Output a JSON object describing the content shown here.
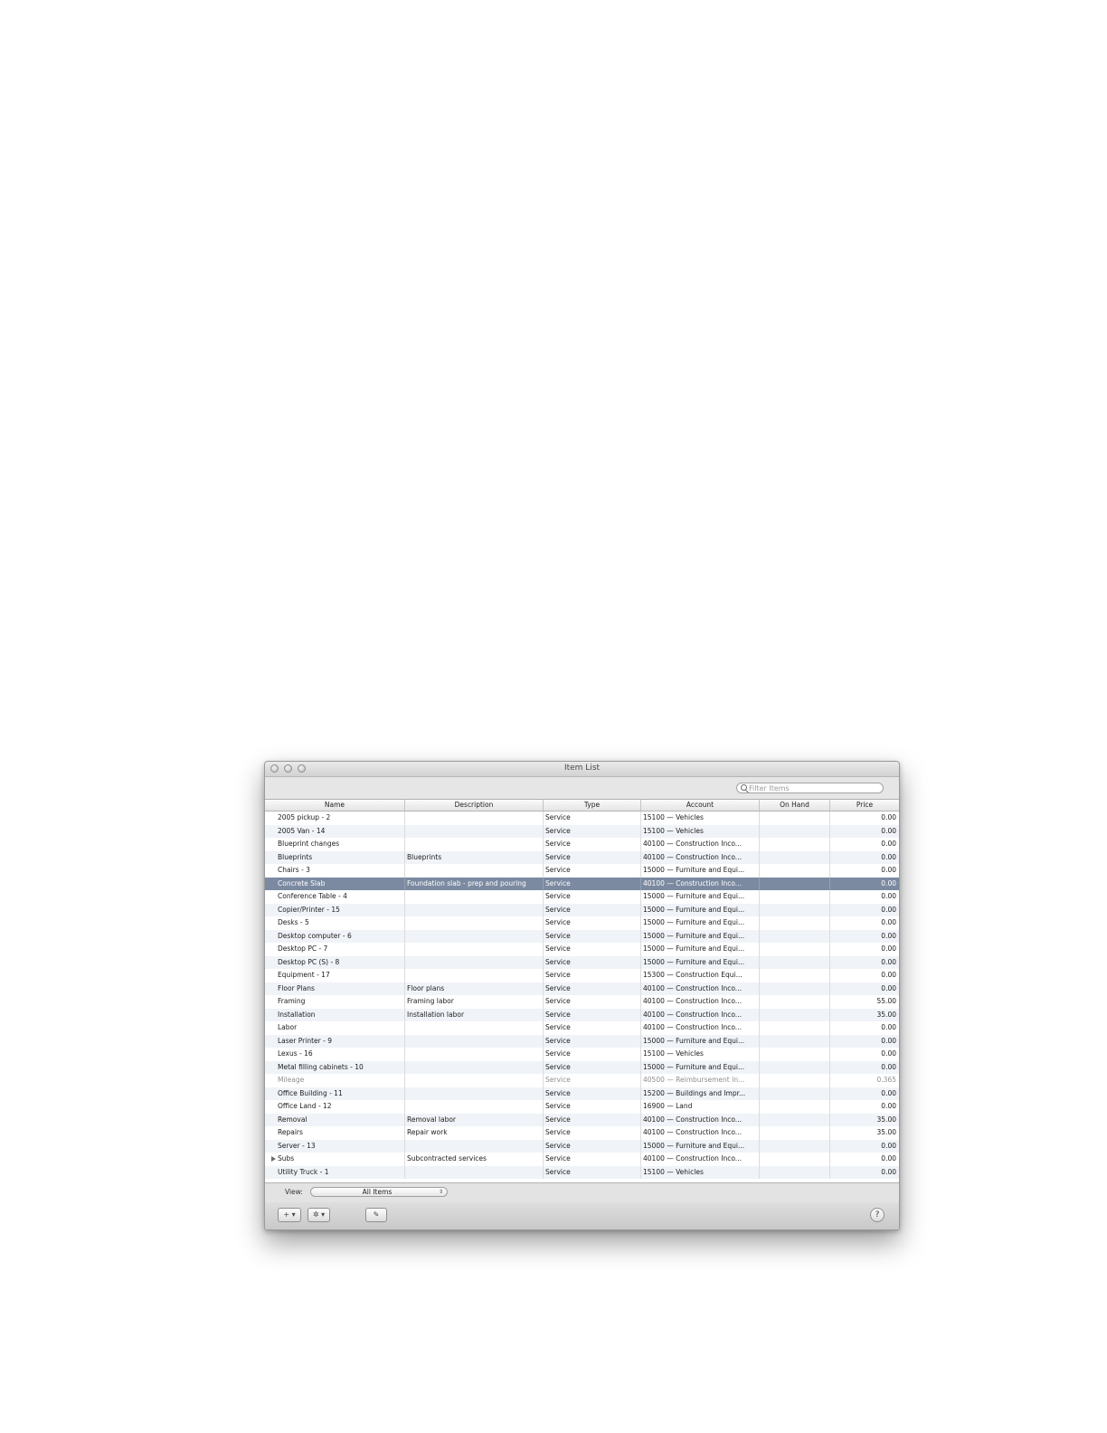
{
  "window": {
    "title": "Item List"
  },
  "search": {
    "placeholder": "Filter Items"
  },
  "table": {
    "columns": [
      "Name",
      "Description",
      "Type",
      "Account",
      "On Hand",
      "Price"
    ],
    "rows": [
      {
        "name": "2005 pickup - 2",
        "description": "",
        "type": "Service",
        "account": "15100 — Vehicles",
        "on_hand": "",
        "price": "0.00"
      },
      {
        "name": "2005 Van - 14",
        "description": "",
        "type": "Service",
        "account": "15100 — Vehicles",
        "on_hand": "",
        "price": "0.00"
      },
      {
        "name": "Blueprint changes",
        "description": "",
        "type": "Service",
        "account": "40100 — Construction Inco...",
        "on_hand": "",
        "price": "0.00"
      },
      {
        "name": "Blueprints",
        "description": "Blueprints",
        "type": "Service",
        "account": "40100 — Construction Inco...",
        "on_hand": "",
        "price": "0.00"
      },
      {
        "name": "Chairs - 3",
        "description": "",
        "type": "Service",
        "account": "15000 — Furniture and Equi...",
        "on_hand": "",
        "price": "0.00"
      },
      {
        "name": "Concrete Slab",
        "description": "Foundation slab - prep and pouring",
        "type": "Service",
        "account": "40100 — Construction Inco...",
        "on_hand": "",
        "price": "0.00",
        "selected": true
      },
      {
        "name": "Conference Table - 4",
        "description": "",
        "type": "Service",
        "account": "15000 — Furniture and Equi...",
        "on_hand": "",
        "price": "0.00"
      },
      {
        "name": "Copier/Printer - 15",
        "description": "",
        "type": "Service",
        "account": "15000 — Furniture and Equi...",
        "on_hand": "",
        "price": "0.00"
      },
      {
        "name": "Desks - 5",
        "description": "",
        "type": "Service",
        "account": "15000 — Furniture and Equi...",
        "on_hand": "",
        "price": "0.00"
      },
      {
        "name": "Desktop computer - 6",
        "description": "",
        "type": "Service",
        "account": "15000 — Furniture and Equi...",
        "on_hand": "",
        "price": "0.00"
      },
      {
        "name": "Desktop PC - 7",
        "description": "",
        "type": "Service",
        "account": "15000 — Furniture and Equi...",
        "on_hand": "",
        "price": "0.00"
      },
      {
        "name": "Desktop PC (S) - 8",
        "description": "",
        "type": "Service",
        "account": "15000 — Furniture and Equi...",
        "on_hand": "",
        "price": "0.00"
      },
      {
        "name": "Equipment - 17",
        "description": "",
        "type": "Service",
        "account": "15300 — Construction Equi...",
        "on_hand": "",
        "price": "0.00"
      },
      {
        "name": "Floor Plans",
        "description": "Floor plans",
        "type": "Service",
        "account": "40100 — Construction Inco...",
        "on_hand": "",
        "price": "0.00"
      },
      {
        "name": "Framing",
        "description": "Framing labor",
        "type": "Service",
        "account": "40100 — Construction Inco...",
        "on_hand": "",
        "price": "55.00"
      },
      {
        "name": "Installation",
        "description": "Installation labor",
        "type": "Service",
        "account": "40100 — Construction Inco...",
        "on_hand": "",
        "price": "35.00"
      },
      {
        "name": "Labor",
        "description": "",
        "type": "Service",
        "account": "40100 — Construction Inco...",
        "on_hand": "",
        "price": "0.00"
      },
      {
        "name": "Laser Printer - 9",
        "description": "",
        "type": "Service",
        "account": "15000 — Furniture and Equi...",
        "on_hand": "",
        "price": "0.00"
      },
      {
        "name": "Lexus - 16",
        "description": "",
        "type": "Service",
        "account": "15100 — Vehicles",
        "on_hand": "",
        "price": "0.00"
      },
      {
        "name": "Metal filling cabinets - 10",
        "description": "",
        "type": "Service",
        "account": "15000 — Furniture and Equi...",
        "on_hand": "",
        "price": "0.00"
      },
      {
        "name": "Mileage",
        "description": "",
        "type": "Service",
        "account": "40500 — Reimbursement In...",
        "on_hand": "",
        "price": "0.365",
        "muted": true
      },
      {
        "name": "Office Building - 11",
        "description": "",
        "type": "Service",
        "account": "15200 — Buildings and Impr...",
        "on_hand": "",
        "price": "0.00"
      },
      {
        "name": "Office Land - 12",
        "description": "",
        "type": "Service",
        "account": "16900 — Land",
        "on_hand": "",
        "price": "0.00"
      },
      {
        "name": "Removal",
        "description": "Removal labor",
        "type": "Service",
        "account": "40100 — Construction Inco...",
        "on_hand": "",
        "price": "35.00"
      },
      {
        "name": "Repairs",
        "description": "Repair work",
        "type": "Service",
        "account": "40100 — Construction Inco...",
        "on_hand": "",
        "price": "35.00"
      },
      {
        "name": "Server - 13",
        "description": "",
        "type": "Service",
        "account": "15000 — Furniture and Equi...",
        "on_hand": "",
        "price": "0.00"
      },
      {
        "name": "Subs",
        "description": "Subcontracted services",
        "type": "Service",
        "account": "40100 — Construction Inco...",
        "on_hand": "",
        "price": "0.00",
        "expandable": true
      },
      {
        "name": "Utility Truck - 1",
        "description": "",
        "type": "Service",
        "account": "15100 — Vehicles",
        "on_hand": "",
        "price": "0.00"
      }
    ]
  },
  "viewbar": {
    "label": "View:",
    "selected": "All Items"
  },
  "bottombar": {
    "add_label": "+ ▾",
    "action_label": "✲ ▾",
    "edit_label": "✎",
    "help_label": "?"
  }
}
